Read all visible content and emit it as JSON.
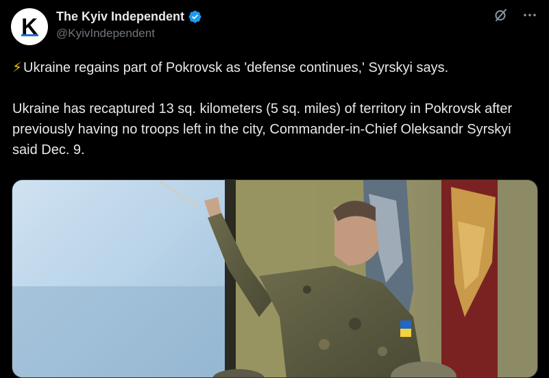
{
  "account": {
    "display_name": "The Kyiv Independent",
    "handle": "@KyivIndependent",
    "avatar_letter": "K",
    "verified": true
  },
  "tweet": {
    "headline_emoji": "⚡",
    "headline": "Ukraine regains part of Pokrovsk as 'defense continues,' Syrskyi says.",
    "body": "Ukraine has recaptured 13 sq. kilometers (5 sq. miles) of territory in Pokrovsk after previously having no troops left in the city, Commander-in-Chief Oleksandr Syrskyi said Dec. 9."
  },
  "icons": {
    "verified": "verified-badge-icon",
    "grok": "grok-icon",
    "more": "more-icon"
  },
  "colors": {
    "background": "#000000",
    "text": "#e7e9ea",
    "secondary_text": "#71767b",
    "verified_blue": "#1d9bf0",
    "accent_bolt": "#f4c20d"
  },
  "media": {
    "kind": "photo"
  }
}
